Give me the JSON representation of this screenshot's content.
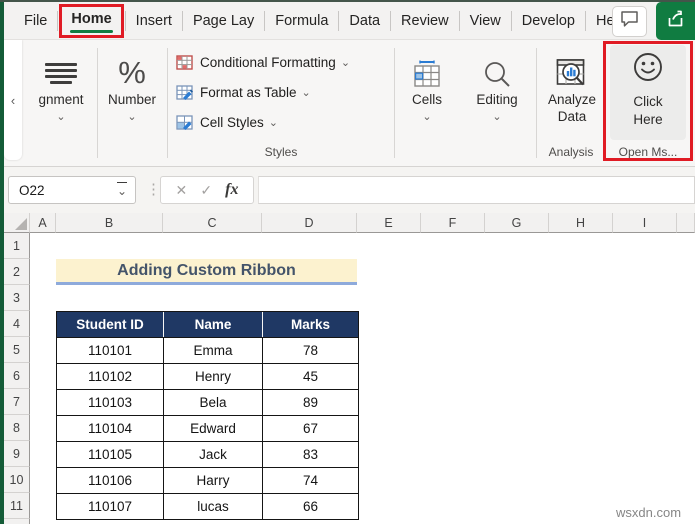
{
  "menu": {
    "tabs": [
      "File",
      "Home",
      "Insert",
      "Page Lay",
      "Formula",
      "Data",
      "Review",
      "View",
      "Develop",
      "Help"
    ],
    "active_tab": "Home",
    "comment_icon": "comment-icon",
    "share_icon": "share-icon"
  },
  "ribbon": {
    "collapse_glyph": "‹",
    "dropdown_glyph": "⌄",
    "alignment": {
      "label": "gnment"
    },
    "number": {
      "label": "Number",
      "glyph": "%"
    },
    "styles": {
      "label": "Styles",
      "items": [
        {
          "label": "Conditional Formatting",
          "icon": "conditional-formatting-icon"
        },
        {
          "label": "Format as Table",
          "icon": "format-as-table-icon"
        },
        {
          "label": "Cell Styles",
          "icon": "cell-styles-icon"
        }
      ]
    },
    "cells": {
      "label": "Cells"
    },
    "editing": {
      "label": "Editing"
    },
    "analyze_data": {
      "label_line1": "Analyze",
      "label_line2": "Data",
      "group": "Analysis"
    },
    "click_here": {
      "label_line1": "Click",
      "label_line2": "Here",
      "group": "Open Ms..."
    }
  },
  "formula_bar": {
    "name_box": "O22",
    "cancel_glyph": "✕",
    "enter_glyph": "✓",
    "fx_glyph": "fx",
    "dots_glyph": "⋮",
    "formula_value": ""
  },
  "sheet": {
    "column_headers": [
      "A",
      "B",
      "C",
      "D",
      "E",
      "F",
      "G",
      "H",
      "I"
    ],
    "row_headers": [
      "1",
      "2",
      "3",
      "4",
      "5",
      "6",
      "7",
      "8",
      "9",
      "10",
      "11"
    ],
    "title_cell": "Adding Custom Ribbon",
    "table": {
      "headers": [
        "Student ID",
        "Name",
        "Marks"
      ],
      "rows": [
        [
          "110101",
          "Emma",
          "78"
        ],
        [
          "110102",
          "Henry",
          "45"
        ],
        [
          "110103",
          "Bela",
          "89"
        ],
        [
          "110104",
          "Edward",
          "67"
        ],
        [
          "110105",
          "Jack",
          "83"
        ],
        [
          "110106",
          "Harry",
          "74"
        ],
        [
          "110107",
          "lucas",
          "66"
        ]
      ]
    }
  },
  "watermark": "wsxdn.com",
  "colors": {
    "accent_green": "#107C41",
    "highlight_red": "#E01B24",
    "table_header_bg": "#1F3864",
    "title_bg": "#FCF2CF",
    "title_underline": "#8EAADB",
    "title_text": "#44546A"
  }
}
